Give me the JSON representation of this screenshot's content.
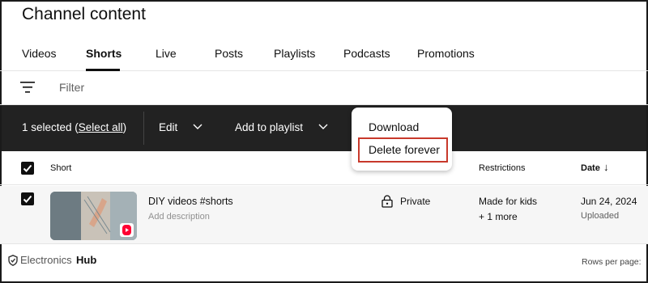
{
  "header": {
    "title": "Channel content"
  },
  "tabs": [
    {
      "label": "Videos"
    },
    {
      "label": "Shorts"
    },
    {
      "label": "Live"
    },
    {
      "label": "Posts"
    },
    {
      "label": "Playlists"
    },
    {
      "label": "Podcasts"
    },
    {
      "label": "Promotions"
    }
  ],
  "active_tab": "Shorts",
  "filter": {
    "placeholder": "Filter"
  },
  "action_bar": {
    "selected_count": "1 selected (",
    "select_all": "Select all",
    "close_paren": ")",
    "edit": "Edit",
    "add_to_playlist": "Add to playlist"
  },
  "dropdown_menu": {
    "items": [
      {
        "label": "Download"
      },
      {
        "label": "Delete forever"
      }
    ],
    "highlight_color": "#c8392b"
  },
  "table": {
    "columns": {
      "short": "Short",
      "restrictions": "Restrictions",
      "date": "Date",
      "sort_arrow": "↓"
    },
    "rows": [
      {
        "title": "DIY videos #shorts",
        "description": "Add description",
        "visibility": "Private",
        "restrictions_line1": "Made for kids",
        "restrictions_line2": "+ 1 more",
        "date": "Jun 24, 2024",
        "date_status": "Uploaded",
        "checked": true
      }
    ]
  },
  "footer": {
    "logo_part1": "Electronics",
    "logo_part2": "Hub",
    "rows_per_page": "Rows per page:"
  },
  "colors": {
    "action_bar_bg": "#222222",
    "shorts_badge": "#ff0033"
  }
}
